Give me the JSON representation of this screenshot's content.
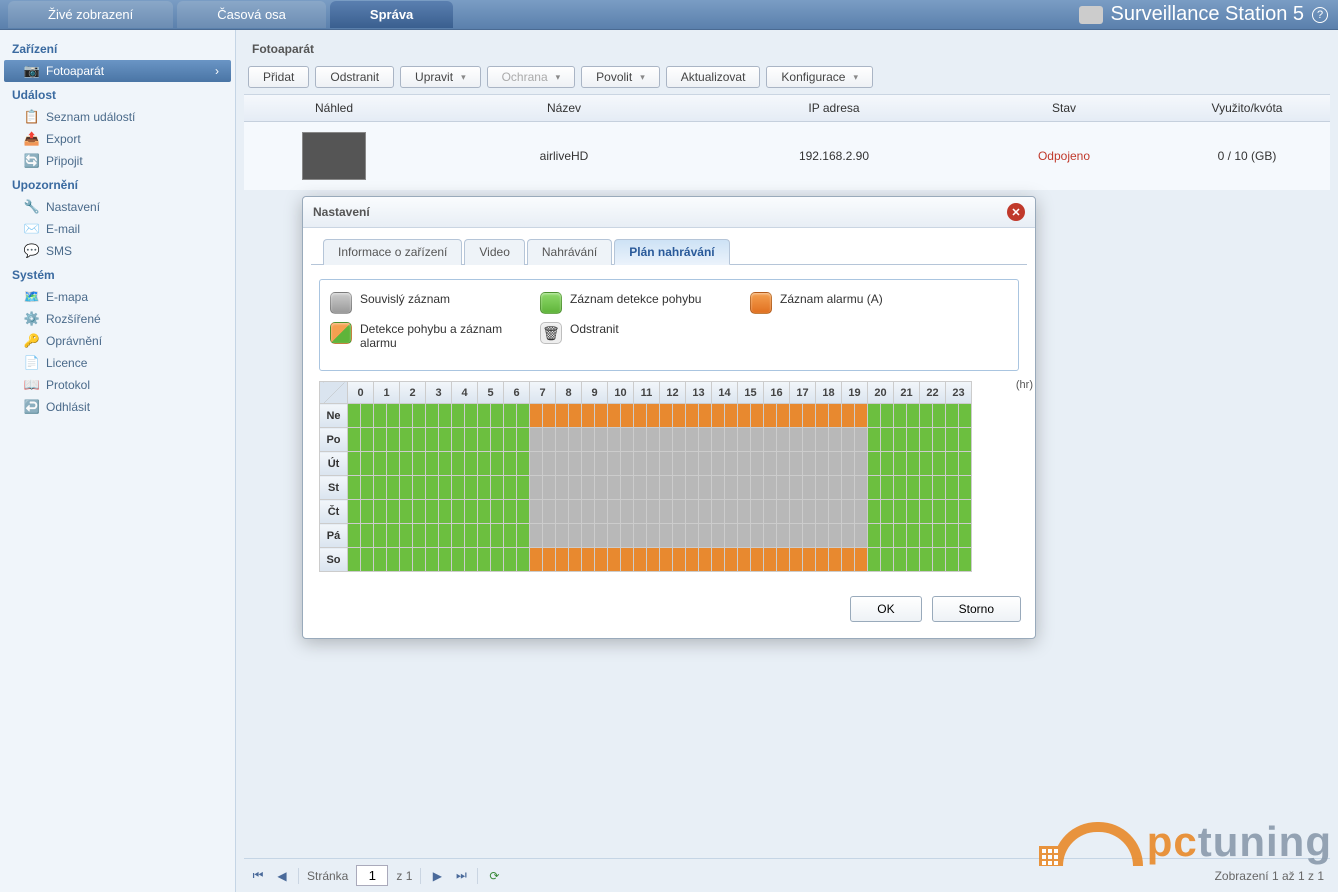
{
  "app_title": "Surveillance Station 5",
  "header_tabs": {
    "live": "Živé zobrazení",
    "timeline": "Časová osa",
    "mgmt": "Správa"
  },
  "sidebar": {
    "devices_header": "Zařízení",
    "camera": "Fotoaparát",
    "events_header": "Událost",
    "event_list": "Seznam událostí",
    "export": "Export",
    "connect": "Připojit",
    "notif_header": "Upozornění",
    "settings": "Nastavení",
    "email": "E-mail",
    "sms": "SMS",
    "system_header": "Systém",
    "emap": "E-mapa",
    "advanced": "Rozšířené",
    "privileges": "Oprávnění",
    "license": "Licence",
    "protocol": "Protokol",
    "logout": "Odhlásit"
  },
  "content": {
    "title": "Fotoaparát",
    "toolbar": {
      "add": "Přidat",
      "remove": "Odstranit",
      "edit": "Upravit",
      "protect": "Ochrana",
      "enable": "Povolit",
      "refresh": "Aktualizovat",
      "config": "Konfigurace"
    },
    "columns": {
      "preview": "Náhled",
      "name": "Název",
      "ip": "IP adresa",
      "state": "Stav",
      "quota": "Využito/kvóta"
    },
    "row": {
      "name": "airliveHD",
      "ip": "192.168.2.90",
      "state": "Odpojeno",
      "quota": "0 / 10 (GB)"
    }
  },
  "pager": {
    "page_label": "Stránka",
    "page_value": "1",
    "of": "z 1",
    "display": "Zobrazení 1 až 1 z 1"
  },
  "modal": {
    "title": "Nastavení",
    "tabs": {
      "device": "Informace o zařízení",
      "video": "Video",
      "rec": "Nahrávání",
      "sched": "Plán nahrávání"
    },
    "legend": {
      "cont": "Souvislý záznam",
      "motion": "Záznam detekce pohybu",
      "alarm": "Záznam alarmu (A)",
      "motion_alarm": "Detekce pohybu a záznam alarmu",
      "delete": "Odstranit"
    },
    "schedule": {
      "hr": "(hr)",
      "hours": [
        "0",
        "1",
        "2",
        "3",
        "4",
        "5",
        "6",
        "7",
        "8",
        "9",
        "10",
        "11",
        "12",
        "13",
        "14",
        "15",
        "16",
        "17",
        "18",
        "19",
        "20",
        "21",
        "22",
        "23"
      ],
      "days": [
        "Ne",
        "Po",
        "Út",
        "St",
        "Čt",
        "Pá",
        "So"
      ],
      "pattern": {
        "Ne": "ggggggggggggggoooooooooooooooooooooooooogggggggg",
        "Po": "ggggggggggggggssssssssssssssssssssssssssgggggggg",
        "Út": "ggggggggggggggssssssssssssssssssssssssssgggggggg",
        "St": "ggggggggggggggssssssssssssssssssssssssssgggggggg",
        "Čt": "ggggggggggggggssssssssssssssssssssssssssgggggggg",
        "Pá": "ggggggggggggggssssssssssssssssssssssssssgggggggg",
        "So": "ggggggggggggggoooooooooooooooooooooooooogggggggg"
      }
    },
    "buttons": {
      "ok": "OK",
      "cancel": "Storno"
    }
  },
  "watermark": {
    "pc": "pc",
    "tuning": "tuning"
  }
}
